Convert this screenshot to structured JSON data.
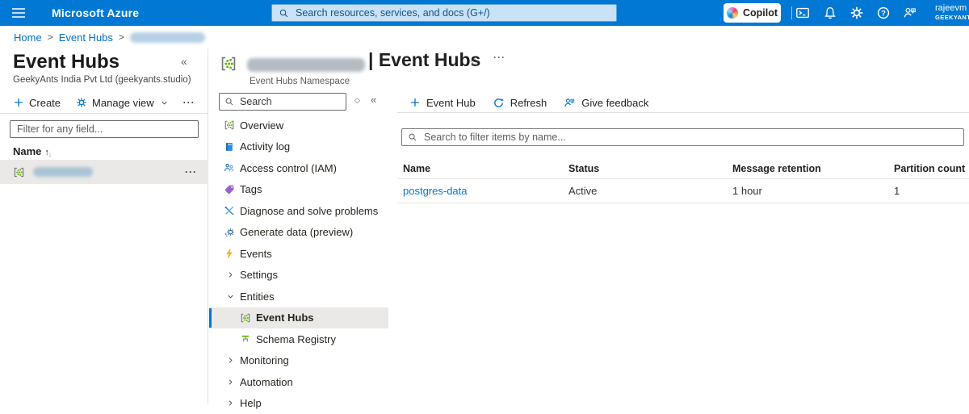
{
  "glyphs": {
    "collapse": "«",
    "ellipsis": "···",
    "star": "☆",
    "sort_asc": "↑",
    "sort_desc": "↓",
    "diamond": "◇",
    "breadcrumb_sep": ">"
  },
  "colors": {
    "topbar": "#0078d4",
    "accent": "#0078d4",
    "selected_bg": "#ebe9e7",
    "event_hub_green": "#5db300",
    "link": "#0078d4"
  },
  "topbar": {
    "brand": "Microsoft Azure",
    "search_placeholder": "Search resources, services, and docs (G+/)",
    "copilot_label": "Copilot",
    "user_name": "rajeevm",
    "user_org": "GEEKYANT"
  },
  "breadcrumb": {
    "items": [
      {
        "label": "Home"
      },
      {
        "label": "Event Hubs"
      }
    ]
  },
  "left_panel": {
    "title": "Event Hubs",
    "subtitle": "GeekyAnts India Pvt Ltd (geekyants.studio)",
    "create_label": "Create",
    "manage_view_label": "Manage view",
    "filter_placeholder": "Filter for any field...",
    "name_column": "Name"
  },
  "blade": {
    "title_suffix": "| Event Hubs",
    "subtitle": "Event Hubs Namespace",
    "search_placeholder": "Search",
    "menu_items": [
      {
        "label": "Overview",
        "icon": "event-hubs-icon"
      },
      {
        "label": "Activity log",
        "icon": "activity-log-icon"
      },
      {
        "label": "Access control (IAM)",
        "icon": "access-control-icon"
      },
      {
        "label": "Tags",
        "icon": "tag-icon"
      },
      {
        "label": "Diagnose and solve problems",
        "icon": "diagnose-icon"
      },
      {
        "label": "Generate data (preview)",
        "icon": "generate-data-icon"
      },
      {
        "label": "Events",
        "icon": "lightning-icon"
      },
      {
        "label": "Settings",
        "icon": "chevron-right-icon",
        "expanded": false
      },
      {
        "label": "Entities",
        "icon": "chevron-down-icon",
        "expanded": true
      },
      {
        "label": "Event Hubs",
        "icon": "event-hubs-icon",
        "selected": true
      },
      {
        "label": "Schema Registry",
        "icon": "schema-registry-icon"
      },
      {
        "label": "Monitoring",
        "icon": "chevron-right-icon",
        "expanded": false
      },
      {
        "label": "Automation",
        "icon": "chevron-right-icon",
        "expanded": false
      },
      {
        "label": "Help",
        "icon": "chevron-right-icon",
        "expanded": false
      }
    ]
  },
  "content": {
    "commands": [
      {
        "label": "Event Hub",
        "icon": "plus-icon"
      },
      {
        "label": "Refresh",
        "icon": "refresh-icon"
      },
      {
        "label": "Give feedback",
        "icon": "person-feedback-icon"
      }
    ],
    "filter_placeholder": "Search to filter items by name...",
    "table": {
      "columns": [
        "Name",
        "Status",
        "Message retention",
        "Partition count"
      ],
      "rows": [
        {
          "name": "postgres-data",
          "status": "Active",
          "retention": "1 hour",
          "partitions": "1"
        }
      ]
    }
  }
}
